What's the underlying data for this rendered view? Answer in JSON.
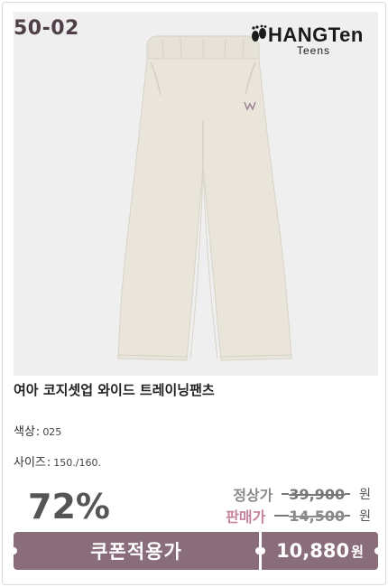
{
  "product": {
    "code": "50-02",
    "brand": {
      "name": "HANGTen",
      "sub": "Teens"
    },
    "title": "여아 코지셋업 와이드 트레이닝팬츠",
    "color": {
      "label": "색상",
      "value": "025"
    },
    "size": {
      "label": "사이즈",
      "value": "150./160."
    },
    "discount": "72%"
  },
  "prices": {
    "regular": {
      "label": "정상가",
      "value": "39,900",
      "unit": "원"
    },
    "sale": {
      "label": "판매가",
      "value": "14,500",
      "unit": "원"
    }
  },
  "buy_bar": {
    "coupon_label": "쿠폰적용가",
    "final_price": "10,880",
    "final_unit": "원"
  },
  "colors": {
    "accent": "#8a6d7b",
    "code_text": "#4f3f48",
    "sale_label": "#c4829c",
    "photo_bg": "#efefef",
    "pants": "#e8e4da"
  },
  "icons": {
    "brand_logo": "footprints-icon"
  }
}
